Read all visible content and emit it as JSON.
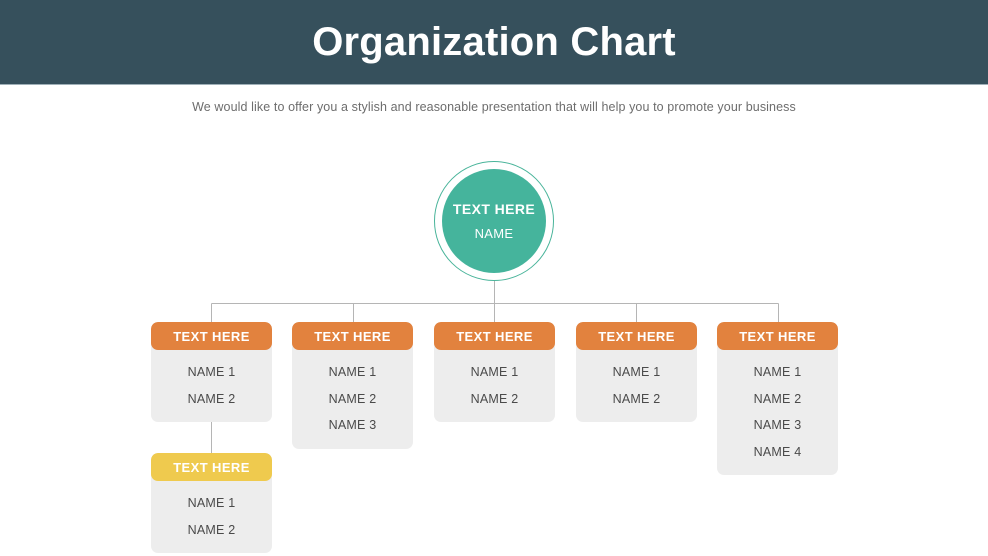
{
  "header": {
    "title": "Organization Chart",
    "background_color": "#36505C",
    "title_color": "#ffffff"
  },
  "subtitle": {
    "text": "We would like to offer you a stylish and reasonable presentation that will help you to promote your business",
    "color": "#6d6d6d"
  },
  "colors": {
    "teal": "#45B49C",
    "orange": "#E2823E",
    "yellow": "#EFCA4E",
    "card_body": "#ededed",
    "connector": "#b5b5b5",
    "name_text": "#4a4a4a"
  },
  "chart_data": {
    "type": "diagram",
    "title": "Organization Chart",
    "subtitle": "We would like to offer you a stylish and reasonable presentation that will help you to promote your business",
    "root": {
      "id": "root",
      "title": "TEXT HERE",
      "name": "NAME",
      "shape": "circle",
      "color": "#45B49C"
    },
    "branches": [
      {
        "id": "branch-1",
        "title": "TEXT HERE",
        "header_color": "#E2823E",
        "names": [
          "NAME 1",
          "NAME 2"
        ]
      },
      {
        "id": "branch-2",
        "title": "TEXT HERE",
        "header_color": "#E2823E",
        "names": [
          "NAME 1",
          "NAME 2",
          "NAME 3"
        ]
      },
      {
        "id": "branch-3",
        "title": "TEXT HERE",
        "header_color": "#E2823E",
        "names": [
          "NAME 1",
          "NAME 2"
        ]
      },
      {
        "id": "branch-4",
        "title": "TEXT HERE",
        "header_color": "#E2823E",
        "names": [
          "NAME 1",
          "NAME 2"
        ]
      },
      {
        "id": "branch-5",
        "title": "TEXT HERE",
        "header_color": "#E2823E",
        "names": [
          "NAME 1",
          "NAME 2",
          "NAME 3",
          "NAME 4"
        ]
      }
    ],
    "sub_branches": [
      {
        "id": "sub-branch-1",
        "parent": "branch-1",
        "title": "TEXT HERE",
        "header_color": "#EFCA4E",
        "names": [
          "NAME 1",
          "NAME 2"
        ]
      }
    ]
  }
}
